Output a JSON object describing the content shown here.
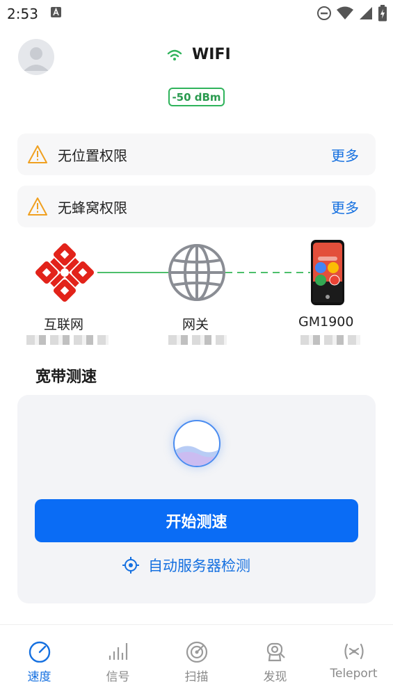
{
  "status_bar": {
    "time": "2:53"
  },
  "header": {
    "network_type": "WIFI",
    "signal": "-50 dBm"
  },
  "permissions": [
    {
      "text": "无位置权限",
      "action": "更多"
    },
    {
      "text": "无蜂窝权限",
      "action": "更多"
    }
  ],
  "topology": {
    "internet": {
      "label": "互联网"
    },
    "gateway": {
      "label": "网关"
    },
    "device": {
      "label": "GM1900"
    }
  },
  "speed_test": {
    "section_title": "宽带测速",
    "start_label": "开始测速",
    "auto_server_label": "自动服务器检测"
  },
  "tabs": [
    {
      "label": "速度",
      "active": true
    },
    {
      "label": "信号",
      "active": false
    },
    {
      "label": "扫描",
      "active": false
    },
    {
      "label": "发现",
      "active": false
    },
    {
      "label": "Teleport",
      "active": false
    }
  ],
  "colors": {
    "accent": "#0a6cf5",
    "signal_green": "#2fb35b",
    "warning": "#f0a020",
    "unicom_red": "#e2231a"
  }
}
